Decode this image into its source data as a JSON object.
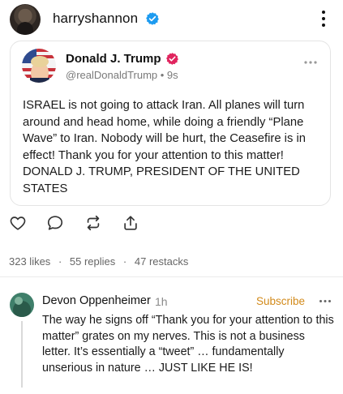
{
  "post": {
    "username": "harryshannon",
    "avatar_icon": "avatar-icon",
    "verified_icon": "verified-badge-icon",
    "more_icon": "vertical-ellipsis-icon"
  },
  "quoted": {
    "name": "Donald J. Trump",
    "handle": "@realDonaldTrump • 9s",
    "text": "ISRAEL is not going to attack Iran. All planes will turn around and head home, while doing a friendly “Plane Wave” to Iran. Nobody will be hurt, the Ceasefire is in effect! Thank you for your attention to this matter! DONALD J. TRUMP, PRESIDENT OF THE UNITED STATES",
    "verified_color": "#e0245e"
  },
  "actions": [
    "heart-icon",
    "comment-icon",
    "repost-icon",
    "share-icon"
  ],
  "stats": {
    "likes": "323 likes",
    "sep1": "·",
    "replies": "55 replies",
    "sep2": "·",
    "restacks": "47 restacks"
  },
  "reply": {
    "name": "Devon Oppenheimer",
    "time": "1h",
    "subscribe": "Subscribe",
    "text": "The way he signs off “Thank you for your attention to this matter” grates on my nerves. This is not a business letter. It’s essentially a  “tweet” … fundamentally unserious in nature … JUST   LIKE HE  IS!"
  },
  "colors": {
    "verified_blue": "#1d9bf0",
    "subscribe_orange": "#d28a1a",
    "muted": "#7a7a7a"
  }
}
